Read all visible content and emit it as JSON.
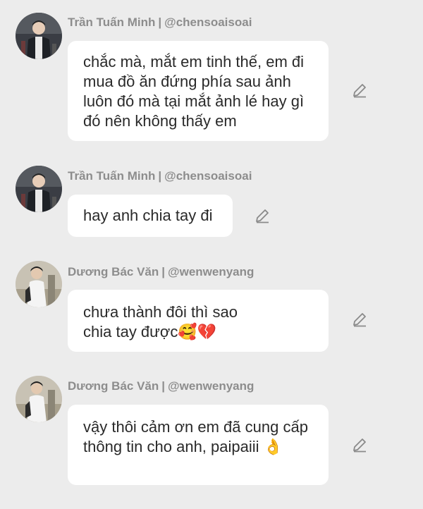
{
  "comments": [
    {
      "display_name": "Trần Tuấn Minh",
      "handle": "@chensoaisoai",
      "separator": "|",
      "text": "chắc mà, mắt em tinh thế, em đi mua đồ ăn đứng phía sau ảnh luôn đó mà tại mắt ảnh lé hay gì đó nên không thấy em",
      "avatar_icon": "user-avatar-photo",
      "edit_icon": "pencil-icon"
    },
    {
      "display_name": "Trần Tuấn Minh",
      "handle": "@chensoaisoai",
      "separator": "|",
      "text": "hay anh chia tay đi",
      "avatar_icon": "user-avatar-photo",
      "edit_icon": "pencil-icon"
    },
    {
      "display_name": "Dương Bác Văn",
      "handle": "@wenwenyang",
      "separator": "|",
      "text": "chưa thành đôi thì sao chia tay được🥰💔",
      "avatar_icon": "user-avatar-photo",
      "edit_icon": "pencil-icon"
    },
    {
      "display_name": "Dương Bác Văn",
      "handle": "@wenwenyang",
      "separator": "|",
      "text": "vậy thôi cảm ơn em đã cung cấp thông tin cho anh, paipaiii 👌",
      "avatar_icon": "user-avatar-photo",
      "edit_icon": "pencil-icon"
    }
  ],
  "colors": {
    "background": "#ececec",
    "bubble": "#ffffff",
    "author_text": "#8d8d8d",
    "message_text": "#2a2a2a",
    "icon": "#8a8a8a"
  }
}
